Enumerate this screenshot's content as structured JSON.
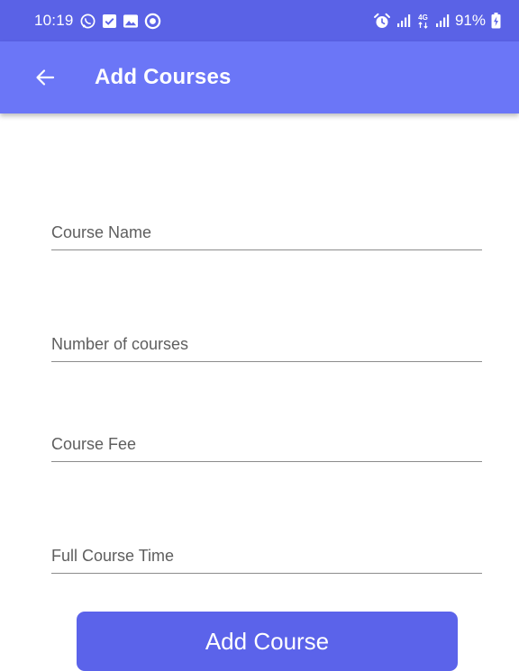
{
  "status_bar": {
    "time": "10:19",
    "battery": "91%",
    "network": "4G",
    "left_icons": [
      "whatsapp-icon",
      "check-square-icon",
      "gallery-icon",
      "record-icon"
    ],
    "right_icons": [
      "alarm-icon",
      "signal-icon",
      "network-4g-icon",
      "signal-icon",
      "battery-charging-icon"
    ]
  },
  "app_bar": {
    "title": "Add Courses",
    "back_icon": "arrow-left-icon"
  },
  "form": {
    "course_name": {
      "placeholder": "Course Name",
      "value": ""
    },
    "number_of_courses": {
      "placeholder": "Number of courses",
      "value": ""
    },
    "course_fee": {
      "placeholder": "Course Fee",
      "value": ""
    },
    "full_course_time": {
      "placeholder": "Full Course Time",
      "value": ""
    },
    "submit_label": "Add Course"
  },
  "colors": {
    "status_bar": "#5a62e6",
    "app_bar": "#6b76f7",
    "button": "#5b63ea",
    "underline": "#8c8c8c",
    "placeholder": "#5e5e5e"
  }
}
